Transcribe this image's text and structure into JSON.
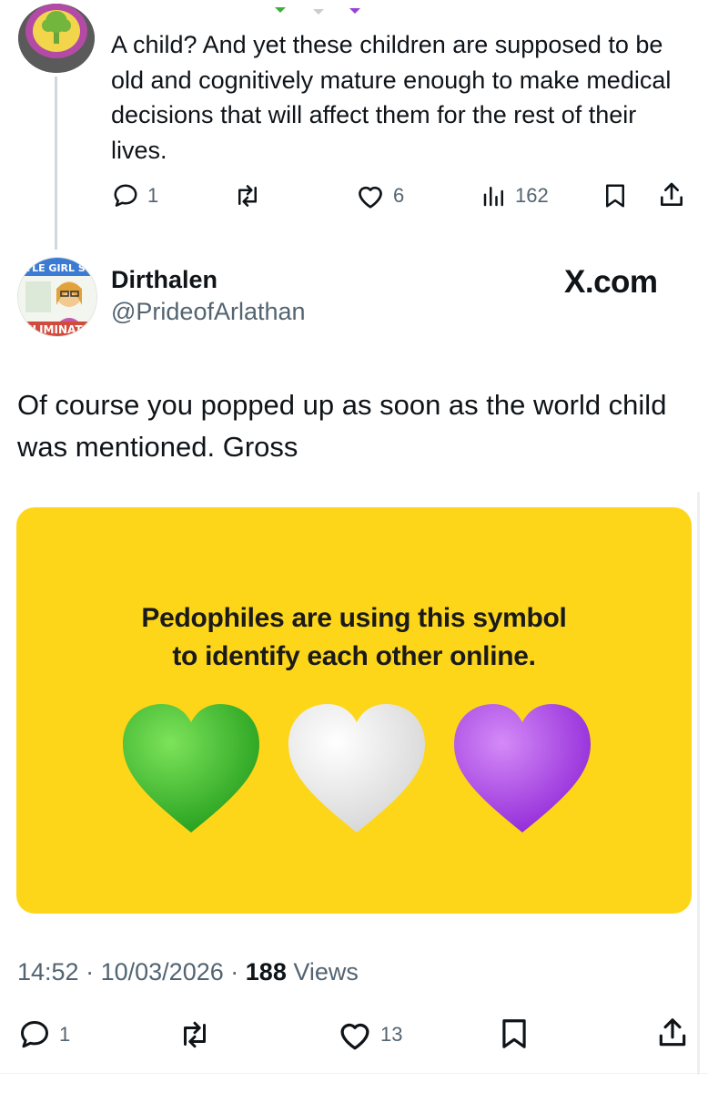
{
  "reply": {
    "text": "A child? And yet these children are supposed to be old and cognitively mature enough to make medical decisions that will affect them for the rest of their lives.",
    "actions": {
      "replies": "1",
      "reposts": "",
      "likes": "6",
      "views": "162"
    }
  },
  "tweet": {
    "display_name": "Dirthalen",
    "handle": "@PrideofArlathan",
    "avatar_caption_top": "LITTLE GIRL STEV",
    "avatar_caption_bottom": "ELIMINATE",
    "text": "Of course you popped up as soon as the world child was mentioned. Gross",
    "media": {
      "line1": "Pedophiles are using this symbol",
      "line2": "to identify each other online.",
      "hearts": [
        "green-heart",
        "white-heart",
        "purple-heart"
      ],
      "background_color": "#fdd61a"
    },
    "time": "14:52",
    "date": "10/03/2026",
    "views_count": "188",
    "views_label": "Views",
    "actions": {
      "replies": "1",
      "reposts": "",
      "likes": "13"
    }
  },
  "watermark": "X.com",
  "colors": {
    "text": "#0f1419",
    "secondary": "#536471",
    "thread_line": "#cfd9de",
    "heart_green": "#2fc02a",
    "heart_white": "#ececec",
    "heart_purple": "#a634e8"
  }
}
